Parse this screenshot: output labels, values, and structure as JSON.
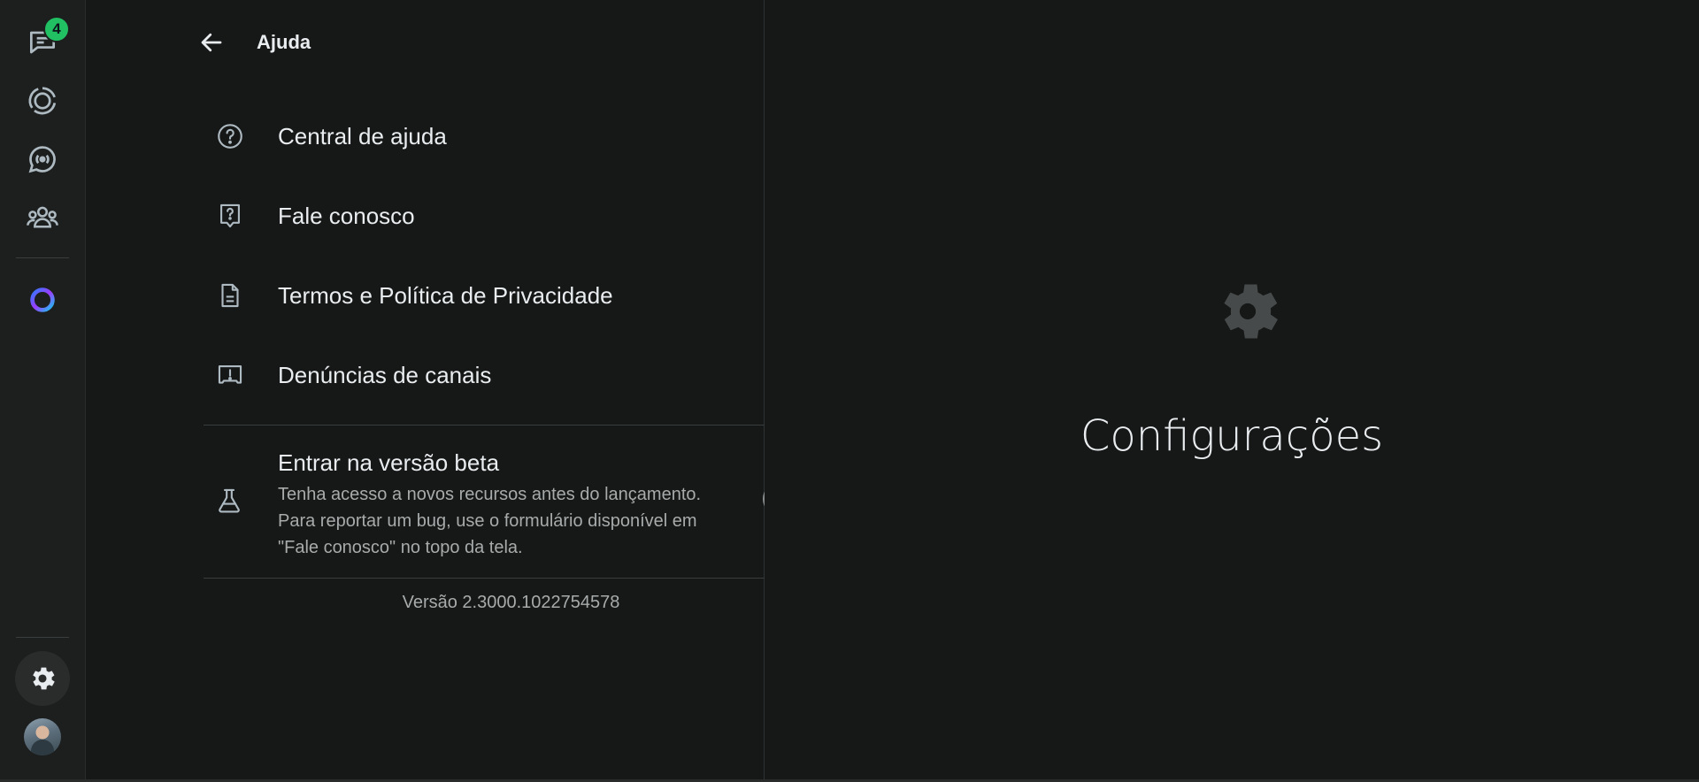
{
  "rail": {
    "chats_badge": "4",
    "items": [
      {
        "icon": "chats-icon"
      },
      {
        "icon": "status-icon"
      },
      {
        "icon": "channels-icon"
      },
      {
        "icon": "communities-icon"
      },
      {
        "icon": "meta-ai-icon"
      }
    ],
    "bottom": [
      {
        "icon": "settings-icon"
      },
      {
        "icon": "profile-avatar"
      }
    ]
  },
  "panel": {
    "title": "Ajuda",
    "items": [
      {
        "label": "Central de ajuda",
        "icon": "help-circle-icon"
      },
      {
        "label": "Fale conosco",
        "icon": "contact-us-icon"
      },
      {
        "label": "Termos e Política de Privacidade",
        "icon": "document-icon"
      },
      {
        "label": "Denúncias de canais",
        "icon": "report-icon"
      }
    ],
    "beta": {
      "title": "Entrar na versão beta",
      "description": "Tenha acesso a novos recursos antes do lançamento. Para reportar um bug,  use o formulário disponível em \"Fale conosco\" no topo da tela.",
      "icon": "flask-icon",
      "enabled": false
    },
    "version": "Versão 2.3000.1022754578"
  },
  "main": {
    "title": "Configurações",
    "icon": "gear-icon"
  },
  "colors": {
    "background": "#161717",
    "rail": "#1d1f1f",
    "text": "#e9edef",
    "muted": "#a8abab",
    "badge": "#21c063"
  }
}
